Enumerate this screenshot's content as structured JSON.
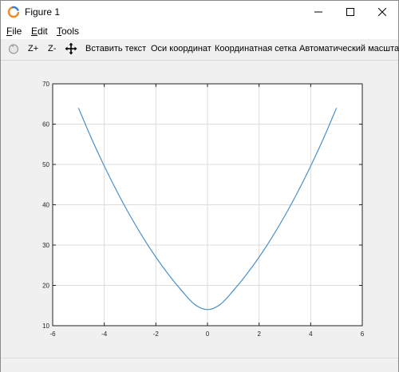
{
  "window": {
    "title": "Figure 1",
    "icon": "octave-logo-icon",
    "controls": [
      "minimize-icon",
      "maximize-icon",
      "close-icon"
    ]
  },
  "menu": {
    "file": "File",
    "edit": "Edit",
    "tools": "Tools"
  },
  "toolbar": {
    "rotate_icon": "rotate-icon",
    "zoom_in": "Z+",
    "zoom_out": "Z-",
    "pan_icon": "pan-icon",
    "insert_text": "Вставить текст",
    "axes": "Оси координат",
    "grid": "Координатная сетка",
    "autoscale": "Автоматический масштаб"
  },
  "colors": {
    "line": "#4a90c8",
    "grid": "#dddddd",
    "axes_box": "#222222",
    "plot_bg": "#ffffff",
    "figure_bg": "#f0f0f0"
  },
  "chart_data": {
    "type": "line",
    "title": "",
    "xlabel": "",
    "ylabel": "",
    "xlim": [
      -6,
      6
    ],
    "ylim": [
      10,
      70
    ],
    "xticks": [
      -6,
      -4,
      -2,
      0,
      2,
      4,
      6
    ],
    "yticks": [
      10,
      20,
      30,
      40,
      50,
      60,
      70
    ],
    "grid": true,
    "series": [
      {
        "x": [
          -5,
          -4.5,
          -4,
          -3.5,
          -3,
          -2.5,
          -2,
          -1.5,
          -1,
          -0.5,
          0,
          0.5,
          1,
          1.5,
          2,
          2.5,
          3,
          3.5,
          4,
          4.5,
          5
        ],
        "y": [
          64,
          56.5,
          49.6,
          43.2,
          37.3,
          31.9,
          27,
          22.6,
          18.7,
          15.3,
          14,
          15.3,
          18.7,
          22.6,
          27,
          31.9,
          37.3,
          43.2,
          49.6,
          56.5,
          64
        ]
      }
    ]
  }
}
